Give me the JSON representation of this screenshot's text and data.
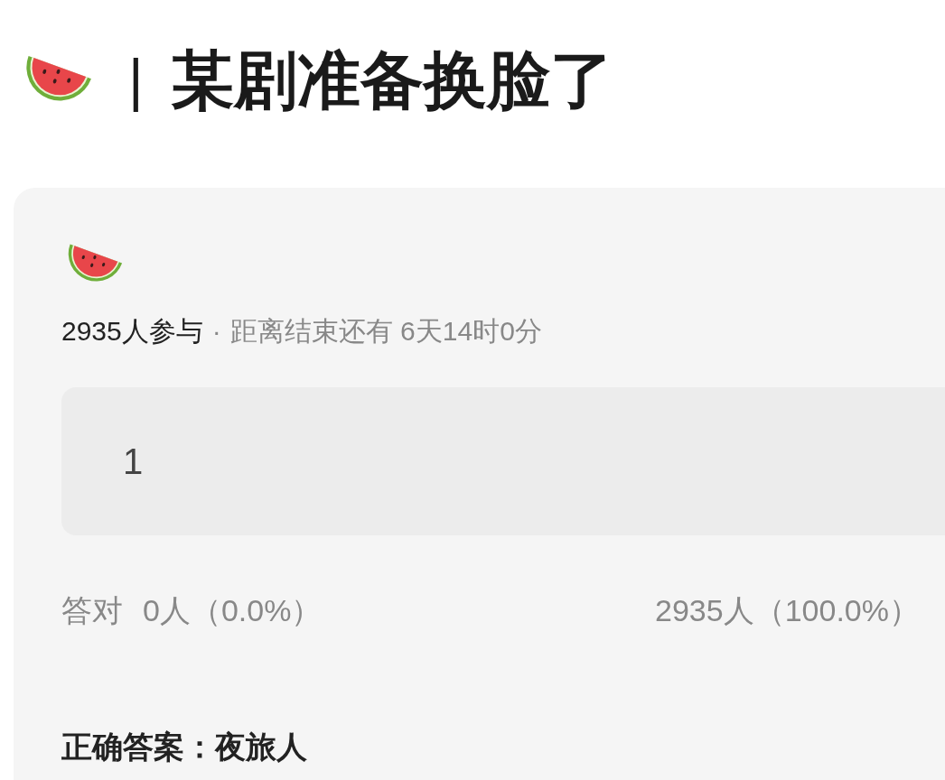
{
  "title": {
    "separator": "|",
    "text": "某剧准备换脸了"
  },
  "quiz": {
    "participants": "2935人参与",
    "separator": "·",
    "deadline": "距离结束还有 6天14时0分",
    "options": [
      {
        "label": "1"
      }
    ],
    "stats": {
      "correct_label": "答对",
      "correct_count": "0人（0.0%）",
      "total": "2935人（100.0%）"
    },
    "answer": "正确答案：夜旅人"
  }
}
